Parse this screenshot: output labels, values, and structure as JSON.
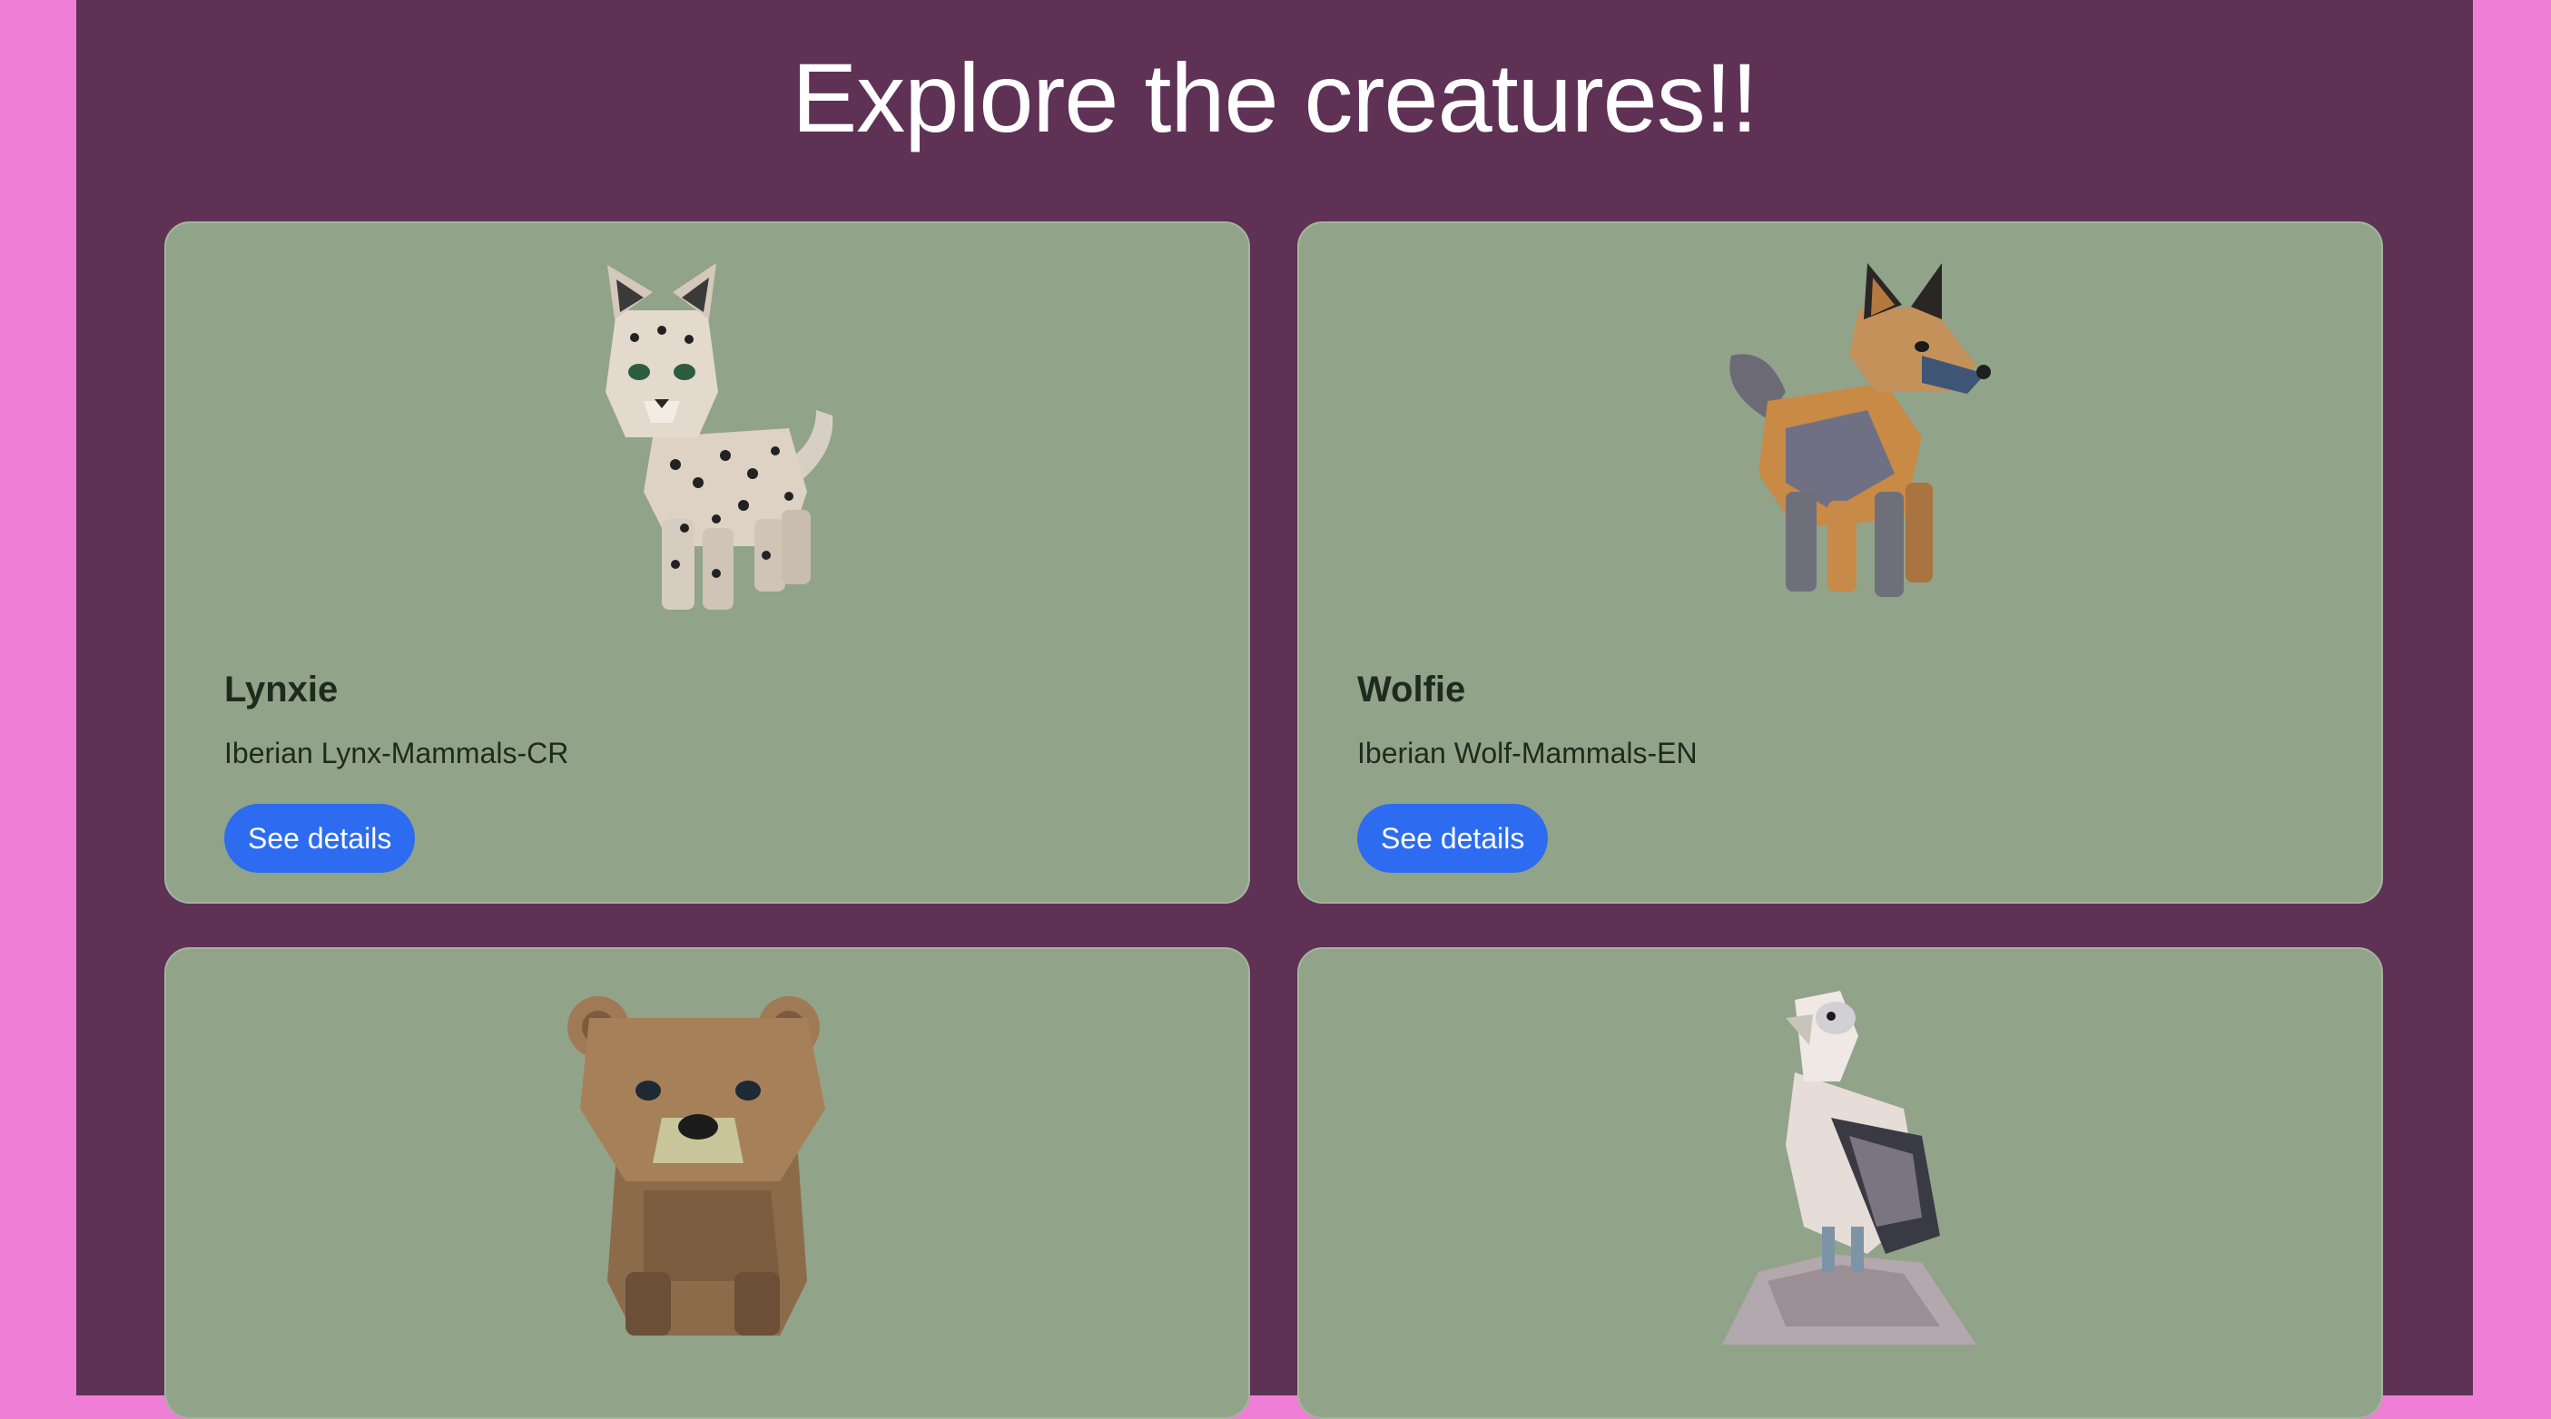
{
  "page": {
    "title": "Explore the creatures!!"
  },
  "cards": [
    {
      "name": "Lynxie",
      "subtitle": "Iberian Lynx-Mammals-CR",
      "button_label": "See details",
      "image_icon": "lynx-illustration"
    },
    {
      "name": "Wolfie",
      "subtitle": "Iberian Wolf-Mammals-EN",
      "button_label": "See details",
      "image_icon": "wolf-illustration"
    },
    {
      "image_icon": "bear-illustration"
    },
    {
      "image_icon": "vulture-illustration"
    }
  ],
  "colors": {
    "page_background": "#ef7fd6",
    "main_background": "#5e3155",
    "card_background": "#91a389",
    "button": "#2d6cf0"
  }
}
